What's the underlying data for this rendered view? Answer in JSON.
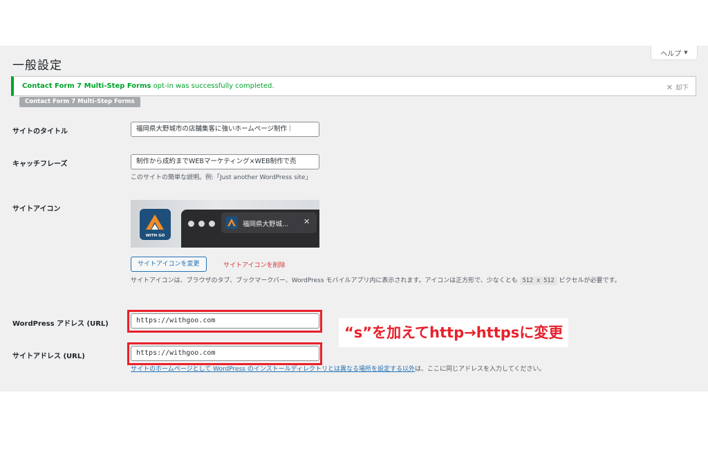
{
  "help": {
    "label": "ヘルプ"
  },
  "page": {
    "title": "一般設定"
  },
  "notice": {
    "plugin": "Contact Form 7 Multi-Step Forms",
    "message": "opt-in was successfully completed.",
    "dismiss": "却下"
  },
  "badge": {
    "label": "Contact Form 7 Multi-Step Forms"
  },
  "fields": {
    "site_title": {
      "label": "サイトのタイトル",
      "value": "福岡県大野城市の店舗集客に強いホームページ制作｜"
    },
    "tagline": {
      "label": "キャッチフレーズ",
      "value": "制作から成約までWEBマーケティング×WEB制作で売",
      "description": "このサイトの簡単な説明。例:「Just another WordPress site」"
    },
    "site_icon": {
      "label": "サイトアイコン",
      "preview_tab_title": "福岡県大野城...",
      "icon_caption": "WITH GO",
      "change_button": "サイトアイコンを変更",
      "remove_link": "サイトアイコンを削除",
      "description_before": "サイトアイコンは、ブラウザのタブ、ブックマークバー、WordPress モバイルアプリ内に表示されます。アイコンは正方形で、少なくとも",
      "size": "512 x 512",
      "description_after": "ピクセルが必要です。"
    },
    "wp_address": {
      "label": "WordPress アドレス (URL)",
      "value": "https://withgoo.com"
    },
    "site_address": {
      "label": "サイトアドレス (URL)",
      "value": "https://withgoo.com",
      "link_text": "サイトのホームページとして WordPress のインストールディレクトリとは異なる場所を設定する以外",
      "description_after": "は、ここに同じアドレスを入力してください。"
    }
  },
  "annotation": {
    "text": "“s”を加えてhttp→httpsに変更"
  },
  "colors": {
    "success": "#00a32a",
    "accent": "#2271b1",
    "danger": "#d63638",
    "highlight": "#e8202a"
  }
}
